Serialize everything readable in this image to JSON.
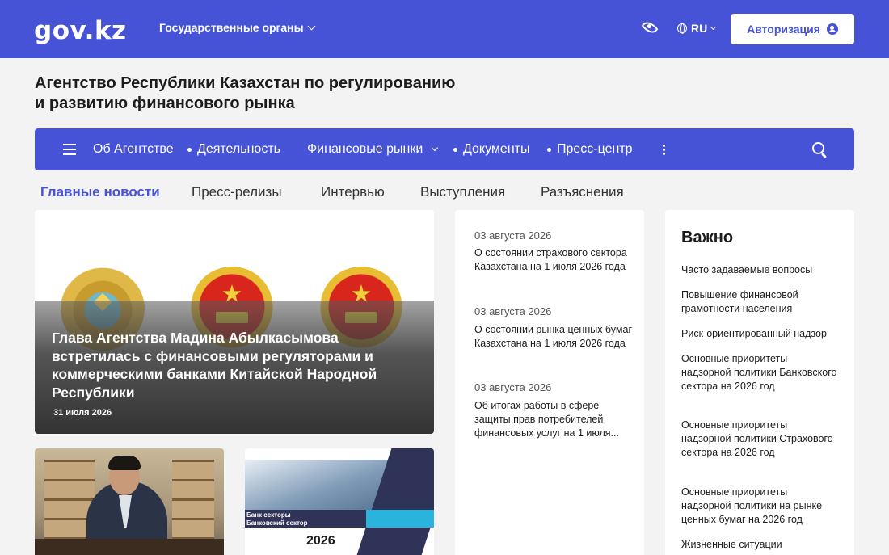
{
  "header": {
    "logo": "gov.kz",
    "gov_organs": "Государственные органы",
    "lang": "RU",
    "auth": "Авторизация"
  },
  "org": {
    "title_line1": "Агентство Республики Казахстан по регулированию",
    "title_line2": "и развитию финансового рынка"
  },
  "nav": {
    "items": [
      "Об Агентстве",
      "Деятельность",
      "Финансовые рынки",
      "Документы",
      "Пресс-центр"
    ]
  },
  "tabs": [
    "Главные новости",
    "Пресс-релизы",
    "Интервью",
    "Выступления",
    "Разъяснения"
  ],
  "hero": {
    "title": "Глава Агентства Мадина Абылкасымова встретилась с финансовыми регуляторами и коммерческими банками Китайской Народной Республики",
    "date": "31 июля 2026"
  },
  "bank_card": {
    "line1": "Банк секторы",
    "line2": "Банковский сектор",
    "year": "2026"
  },
  "news": [
    {
      "date": "03 августа 2026",
      "title": "О состоянии страхового сектора Казахстана на 1 июля 2026 года"
    },
    {
      "date": "03 августа 2026",
      "title": "О состоянии рынка ценных бумаг Казахстана на 1 июля 2026 года"
    },
    {
      "date": "03 августа 2026",
      "title": "Об итогах работы в сфере защиты прав потребителей финансовых услуг на 1 июля..."
    }
  ],
  "important": {
    "title": "Важно",
    "links": [
      "Часто задаваемые вопросы",
      "Повышение финансовой грамотности населения",
      "Риск-ориентированный надзор",
      "Основные приоритеты надзорной политики Банковского сектора на 2026 год",
      "Основные приоритеты надзорной политики Страхового сектора на 2026 год",
      "Основные приоритеты надзорной политики на рынке ценных бумаг на 2026 год",
      "Жизненные ситуации"
    ]
  },
  "colors": {
    "brand": "#4653d6",
    "background": "#f3f3f3"
  }
}
